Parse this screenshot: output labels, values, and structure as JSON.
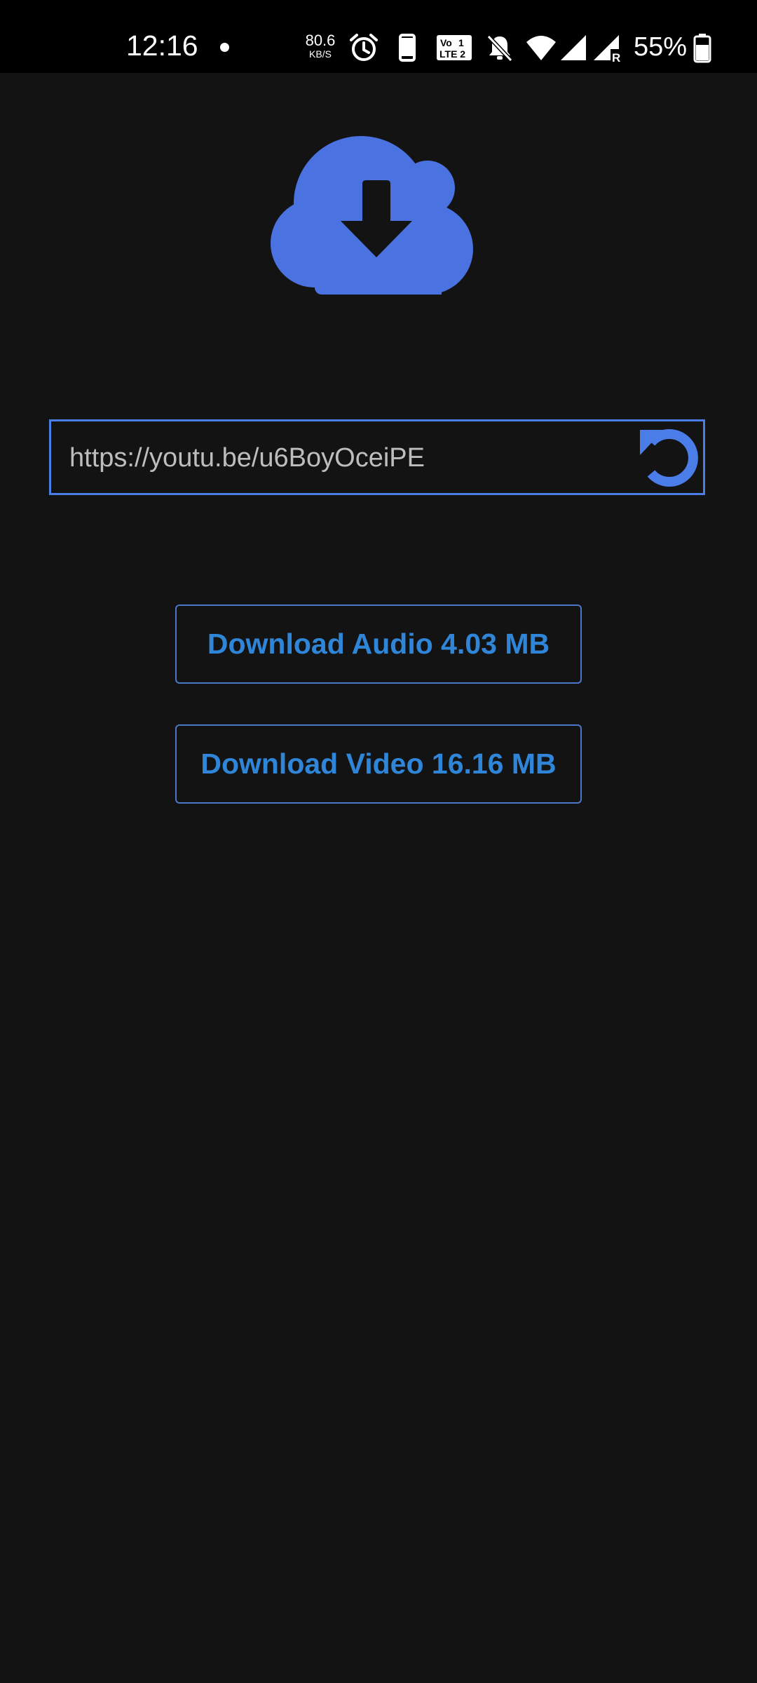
{
  "status_bar": {
    "time": "12:16",
    "net_speed_value": "80.6",
    "net_speed_unit": "KB/S",
    "volte_label": "Vo) LTE 2",
    "battery_percent": "55%",
    "icons": [
      "alarm-icon",
      "phone-icon",
      "volte-icon",
      "bell-off-icon",
      "wifi-icon",
      "signal-icon",
      "signal-roaming-icon",
      "battery-icon"
    ]
  },
  "main": {
    "logo_icon": "cloud-download-icon",
    "logo_color": "#4a72e0",
    "url_field": {
      "value": "https://youtu.be/u6BoyOceiPE",
      "refresh_icon": "refresh-icon"
    },
    "buttons": {
      "audio_label": "Download Audio 4.03 MB",
      "video_label": "Download Video 16.16 MB"
    }
  },
  "colors": {
    "background": "#141314",
    "accent": "#4a7de8",
    "button_text": "#2f86d8"
  }
}
